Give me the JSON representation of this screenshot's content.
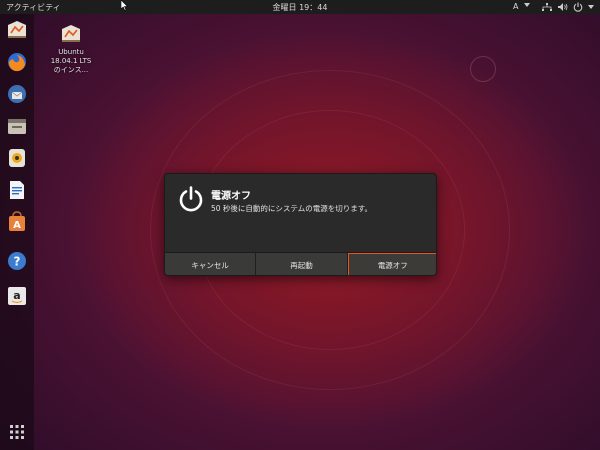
{
  "topbar": {
    "activities": "アクティビティ",
    "clock": "金曜日 19：44",
    "input_method": "A",
    "icons": [
      "network-icon",
      "volume-icon",
      "power-icon"
    ]
  },
  "dock": {
    "items": [
      "files-install-icon",
      "firefox-icon",
      "thunderbird-icon",
      "file-manager-icon",
      "rhythmbox-icon",
      "libreoffice-writer-icon",
      "software-center-icon",
      "help-icon",
      "amazon-icon"
    ],
    "show_apps": "apps-grid-icon"
  },
  "desktop": {
    "icon_label_line1": "Ubuntu",
    "icon_label_line2": "18.04.1 LTS",
    "icon_label_line3": "のインス..."
  },
  "dialog": {
    "title": "電源オフ",
    "message": "50 秒後に自動的にシステムの電源を切ります。",
    "buttons": {
      "cancel": "キャンセル",
      "restart": "再起動",
      "power_off": "電源オフ"
    }
  },
  "colors": {
    "accent": "#e95420",
    "dialog_bg": "#2a2a2a",
    "topbar_bg": "#1d1d1d"
  }
}
